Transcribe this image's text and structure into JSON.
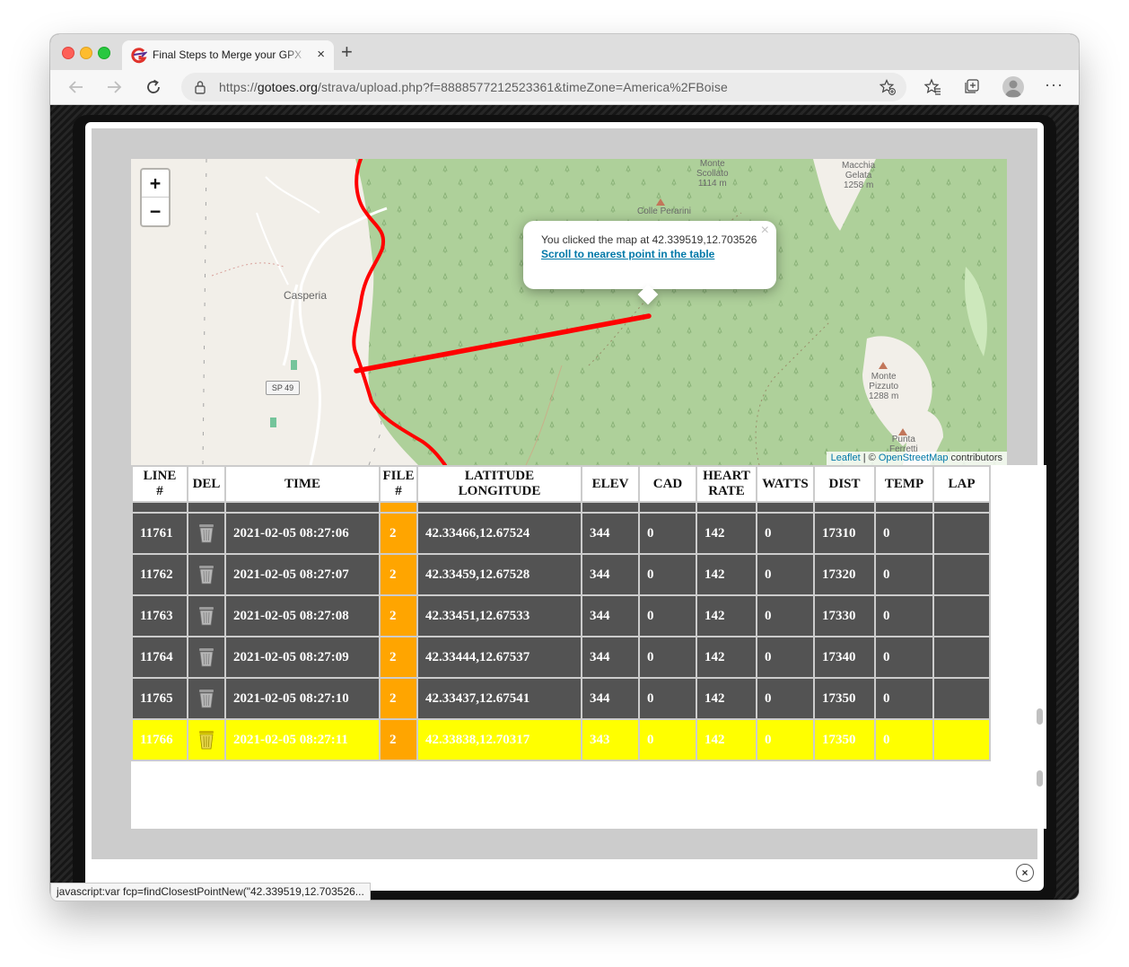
{
  "browser": {
    "tab_title": "Final Steps to Merge your GPX",
    "tab_close": "×",
    "new_tab": "+",
    "url_prefix": "https://",
    "url_host": "gotoes.org",
    "url_path": "/strava/upload.php?f=8888577212523361&timeZone=America%2FBoise",
    "more_menu": "···",
    "status_text": "javascript:var fcp=findClosestPointNew(\"42.339519,12.703526..."
  },
  "map": {
    "zoom_in": "+",
    "zoom_out": "−",
    "popup_text": "You clicked the map at 42.339519,12.703526",
    "popup_link": "Scroll to nearest point in the table",
    "popup_close": "×",
    "attribution_leaflet": "Leaflet",
    "attribution_sep": " | © ",
    "attribution_osm": "OpenStreetMap",
    "attribution_rest": " contributors",
    "labels": {
      "monte_scollato": "Monte\nScollato\n1114 m",
      "macchia_gelata": "Macchia\nGelata\n1258 m",
      "colle_perarini": "Colle Perarini",
      "casperia": "Casperia",
      "road_shield": "SP 49",
      "monte_pizzuto": "Monte\nPizzuto\n1288 m",
      "punta_ferretti": "Punta\nFerretti"
    },
    "colors": {
      "track": "#ff0000",
      "forest": "#aed09a",
      "land": "#f2efe9"
    }
  },
  "table": {
    "headers": [
      "LINE\n#",
      "DEL",
      "TIME",
      "FILE\n#",
      "LATITUDE\nLONGITUDE",
      "ELEV",
      "CAD",
      "HEART\nRATE",
      "WATTS",
      "DIST",
      "TEMP",
      "LAP"
    ],
    "rows": [
      {
        "line": "11761",
        "time": "2021-02-05 08:27:06",
        "file": "2",
        "latlon": "42.33466,12.67524",
        "elev": "344",
        "cad": "0",
        "hr": "142",
        "watts": "0",
        "dist": "17310",
        "temp": "0",
        "lap": ""
      },
      {
        "line": "11762",
        "time": "2021-02-05 08:27:07",
        "file": "2",
        "latlon": "42.33459,12.67528",
        "elev": "344",
        "cad": "0",
        "hr": "142",
        "watts": "0",
        "dist": "17320",
        "temp": "0",
        "lap": ""
      },
      {
        "line": "11763",
        "time": "2021-02-05 08:27:08",
        "file": "2",
        "latlon": "42.33451,12.67533",
        "elev": "344",
        "cad": "0",
        "hr": "142",
        "watts": "0",
        "dist": "17330",
        "temp": "0",
        "lap": ""
      },
      {
        "line": "11764",
        "time": "2021-02-05 08:27:09",
        "file": "2",
        "latlon": "42.33444,12.67537",
        "elev": "344",
        "cad": "0",
        "hr": "142",
        "watts": "0",
        "dist": "17340",
        "temp": "0",
        "lap": ""
      },
      {
        "line": "11765",
        "time": "2021-02-05 08:27:10",
        "file": "2",
        "latlon": "42.33437,12.67541",
        "elev": "344",
        "cad": "0",
        "hr": "142",
        "watts": "0",
        "dist": "17350",
        "temp": "0",
        "lap": ""
      },
      {
        "line": "11766",
        "time": "2021-02-05 08:27:11",
        "file": "2",
        "latlon": "42.33838,12.70317",
        "elev": "343",
        "cad": "0",
        "hr": "142",
        "watts": "0",
        "dist": "17350",
        "temp": "0",
        "lap": "",
        "highlight": true
      }
    ],
    "colors": {
      "row": "#535353",
      "file_cell": "#ffa500",
      "highlight": "#ffff00",
      "grid": "#cccccc"
    }
  },
  "modal": {
    "close": "×"
  }
}
